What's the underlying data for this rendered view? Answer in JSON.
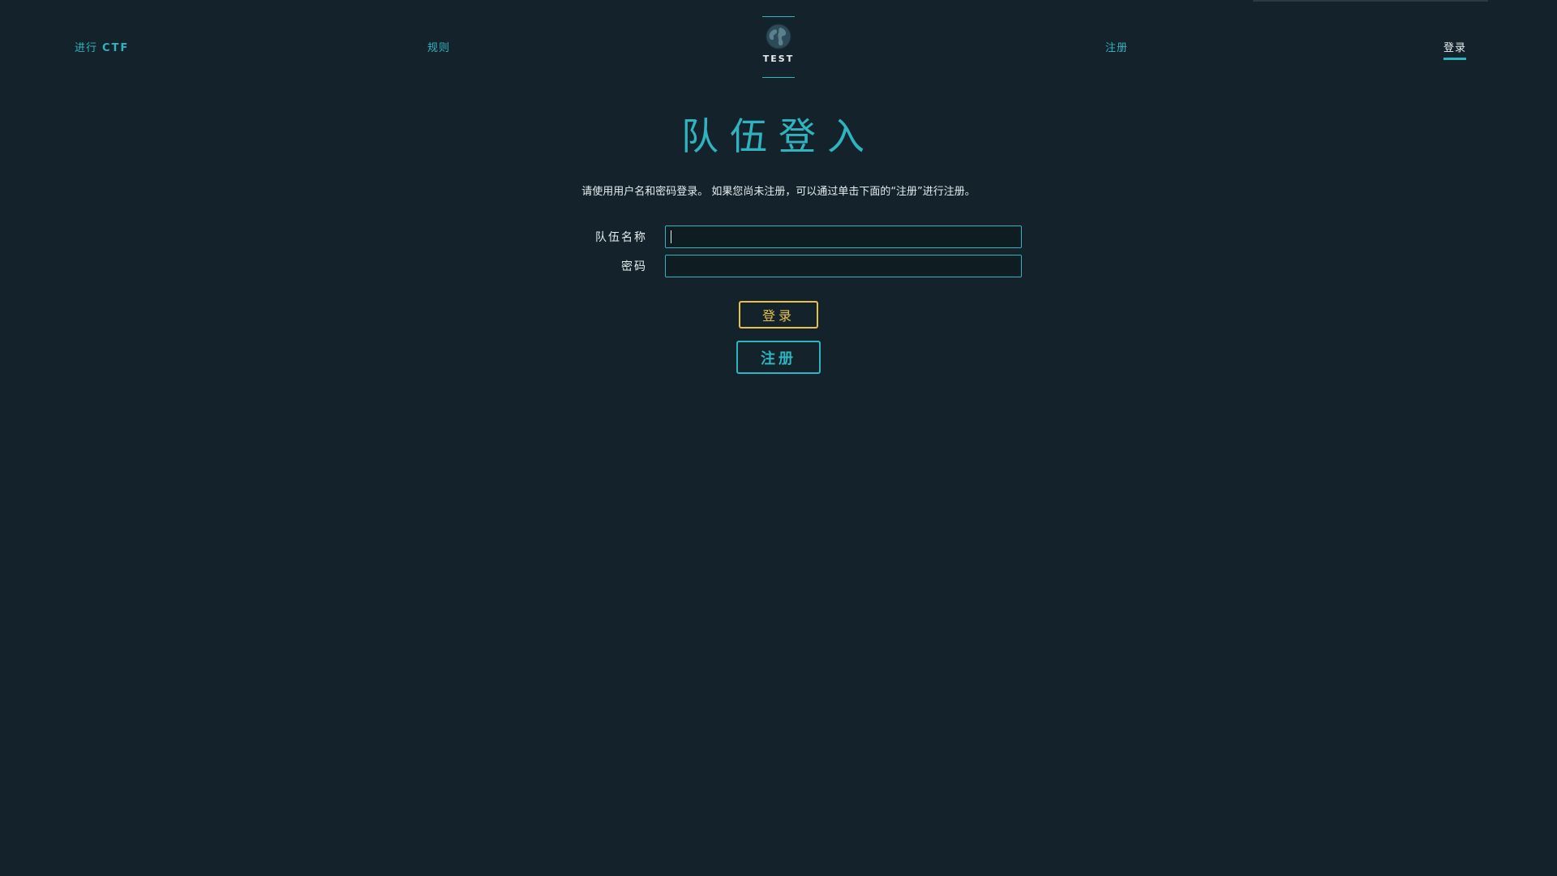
{
  "nav": {
    "play_prefix": "进行",
    "play_ctf": "CTF",
    "rules": "规则",
    "register": "注册",
    "login": "登录"
  },
  "logo": {
    "text": "TEST",
    "icon": "globe-icon"
  },
  "page": {
    "title": "队伍登入",
    "intro": "请使用用户名和密码登录。 如果您尚未注册，可以通过单击下面的“注册”进行注册。"
  },
  "form": {
    "team_name_label": "队伍名称",
    "team_name_value": "",
    "password_label": "密码",
    "password_value": "",
    "login_button": "登录",
    "register_button": "注册"
  },
  "colors": {
    "background": "#14232b",
    "accent": "#2fb3bf",
    "login_button": "#e6c24a",
    "text": "#e6eef0"
  }
}
